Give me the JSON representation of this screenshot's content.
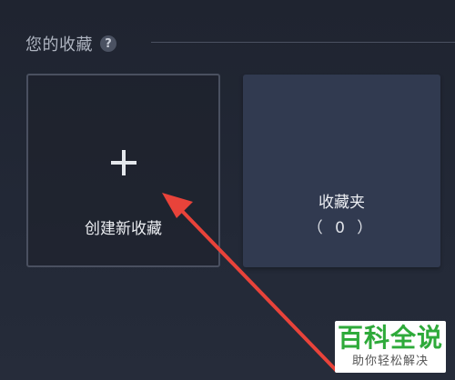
{
  "section": {
    "title": "您的收藏",
    "help_icon": "?"
  },
  "create_card": {
    "icon": "plus-icon",
    "label": "创建新收藏"
  },
  "folder_card": {
    "name": "收藏夹",
    "count": "（ 0 ）"
  },
  "annotation": {
    "arrow_color": "#e8433a"
  },
  "watermark": {
    "title": "百科全说",
    "subtitle": "助你轻松解决"
  },
  "colors": {
    "background": "#222836",
    "folder_card": "#313a50",
    "watermark_green": "#2eaa3a"
  }
}
